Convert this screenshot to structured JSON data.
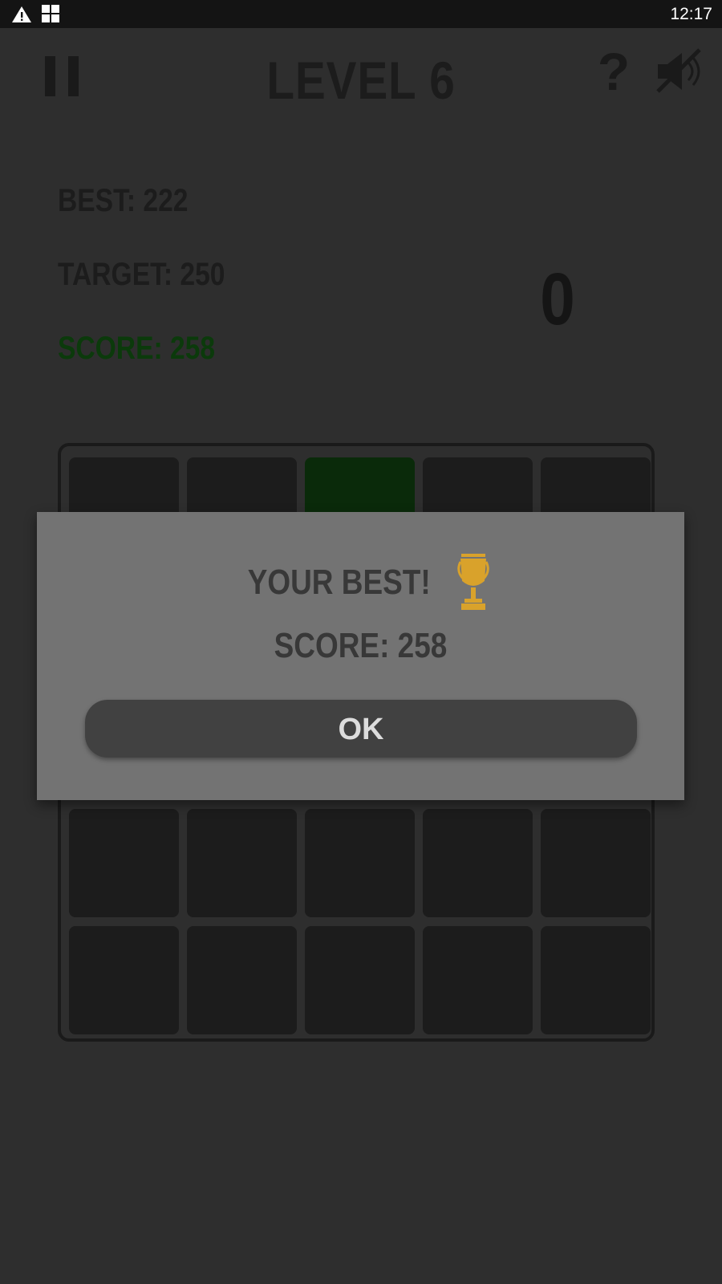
{
  "status_bar": {
    "time": "12:17",
    "icons": [
      "warning-icon",
      "grid-icon"
    ]
  },
  "header": {
    "title": "LEVEL 6",
    "pause_icon": "pause-icon",
    "help_label": "?",
    "mute_icon": "sound-muted-icon"
  },
  "stats": {
    "best": "BEST: 222",
    "target": "TARGET: 250",
    "score": "SCORE: 258",
    "combo": "0"
  },
  "board": {
    "rows": 5,
    "cols": 5,
    "active_tiles": [
      [
        0,
        2
      ]
    ]
  },
  "dialog": {
    "title": "YOUR BEST!",
    "trophy_icon": "trophy-icon",
    "score": "SCORE: 258",
    "ok_label": "OK"
  },
  "colors": {
    "background": "#2e2e2e",
    "dialog": "#737373",
    "score_green": "#0b3a0b",
    "trophy_gold": "#d9a22b"
  }
}
